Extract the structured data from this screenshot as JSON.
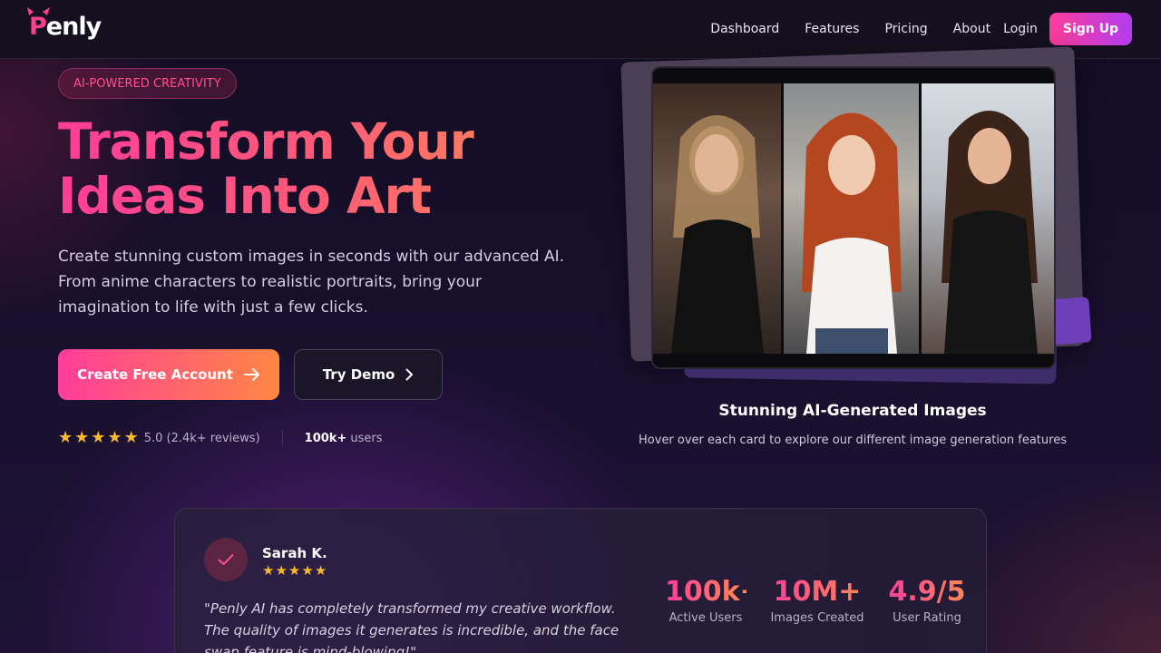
{
  "nav": {
    "logo_letter": "P",
    "logo_rest": "enly",
    "links": [
      "Dashboard",
      "Features",
      "Pricing",
      "About"
    ],
    "login": "Login",
    "signup": "Sign Up"
  },
  "hero": {
    "badge": "AI-POWERED CREATIVITY",
    "headline_line1": "Transform Your",
    "headline_line2": "Ideas Into Art",
    "subtext": "Create stunning custom images in seconds with our advanced AI. From anime characters to realistic portraits, bring your imagination to life with just a few clicks.",
    "cta_primary": "Create Free Account",
    "cta_secondary": "Try Demo",
    "rating_stars": 5,
    "rating_text": "5.0 (2.4k+ reviews)",
    "users_value": "100k+",
    "users_label": "users"
  },
  "gallery": {
    "title": "Stunning AI-Generated Images",
    "subtitle": "Hover over each card to explore our different image generation features"
  },
  "testimonial": {
    "name": "Sarah K.",
    "stars": 5,
    "quote": "\"Penly AI has completely transformed my creative workflow. The quality of images it generates is incredible, and the face swap feature is mind-blowing!\""
  },
  "stats": [
    {
      "value": "100k+",
      "label": "Active Users"
    },
    {
      "value": "10M+",
      "label": "Images Created"
    },
    {
      "value": "4.9/5",
      "label": "User Rating"
    }
  ],
  "colors": {
    "accent_pink": "#ff3d9a",
    "accent_orange": "#ff8a55",
    "star": "#f5b82e"
  }
}
